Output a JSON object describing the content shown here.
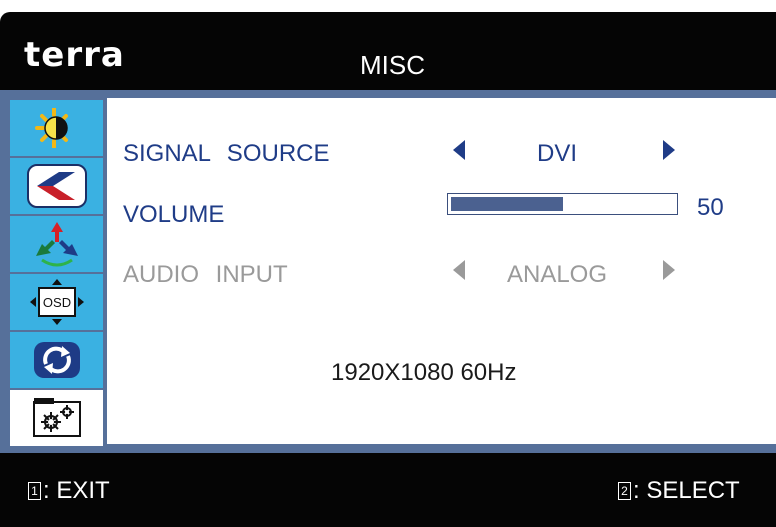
{
  "header": {
    "logo": "terra",
    "title": "MISC"
  },
  "sidebar": {
    "items": [
      {
        "name": "brightness-contrast",
        "icon": "sun-contrast-icon",
        "selected": false
      },
      {
        "name": "image-setup",
        "icon": "image-setup-icon",
        "selected": false
      },
      {
        "name": "color",
        "icon": "color-rgb-icon",
        "selected": false
      },
      {
        "name": "osd-setup",
        "icon": "osd-position-icon",
        "label": "OSD",
        "selected": false
      },
      {
        "name": "reset",
        "icon": "reset-arrows-icon",
        "selected": false
      },
      {
        "name": "misc",
        "icon": "gears-icon",
        "selected": true
      }
    ]
  },
  "menu": {
    "signal_source": {
      "label": "SIGNAL SOURCE",
      "value": "DVI",
      "enabled": true
    },
    "volume": {
      "label": "VOLUME",
      "value": "50",
      "level": 0.5,
      "enabled": true
    },
    "audio_input": {
      "label": "AUDIO INPUT",
      "value": "ANALOG",
      "enabled": false
    }
  },
  "info": {
    "resolution": "1920X1080 60Hz"
  },
  "footer": {
    "exit_key": "1",
    "exit_label": ": EXIT",
    "select_key": "2",
    "select_label": ": SELECT"
  },
  "colors": {
    "background": "#050505",
    "frame": "#56709a",
    "sidebar_tab": "#3ab1e2",
    "active_text": "#1f3c87",
    "disabled_text": "#9a9a9a"
  }
}
